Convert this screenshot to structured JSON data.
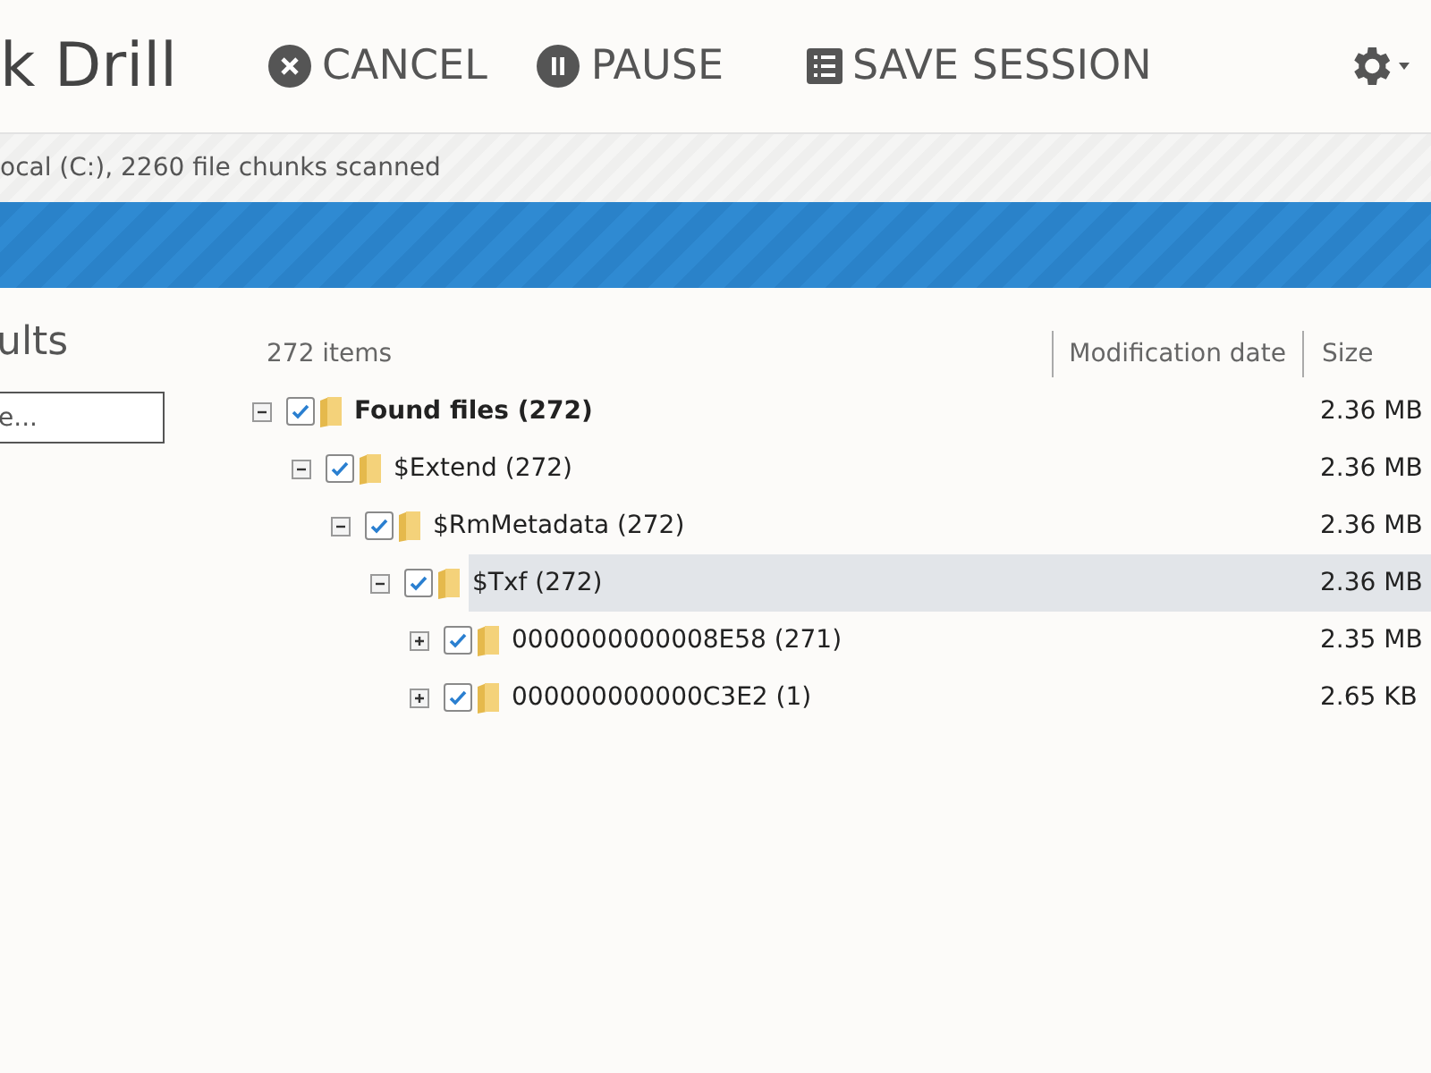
{
  "header": {
    "title": "k Drill",
    "buttons": [
      {
        "label": "CANCEL",
        "kind": "cancel"
      },
      {
        "label": "PAUSE",
        "kind": "pause"
      },
      {
        "label": "SAVE SESSION",
        "kind": "save"
      }
    ]
  },
  "status_text": "ocal (C:), 2260 file chunks scanned",
  "progress": {
    "level": 1
  },
  "sidebar": {
    "heading": "ults",
    "search": {
      "placeholder": "e..."
    }
  },
  "table": {
    "item_count": "272 items",
    "columns": [
      "Modification date",
      "Size"
    ],
    "rows": [
      {
        "name": "Found files (272)",
        "bold": true,
        "size": "2.36 MB",
        "checked": true,
        "expanded": true,
        "selected": false,
        "children": [
          {
            "name": "$Extend (272)",
            "bold": false,
            "size": "2.36 MB",
            "checked": true,
            "expanded": true,
            "selected": false,
            "children": [
              {
                "name": "$RmMetadata (272)",
                "bold": false,
                "size": "2.36 MB",
                "checked": true,
                "expanded": true,
                "selected": false,
                "children": [
                  {
                    "name": "$Txf (272)",
                    "bold": false,
                    "size": "2.36 MB",
                    "checked": true,
                    "expanded": true,
                    "selected": true,
                    "children": [
                      {
                        "name": "0000000000008E58 (271)",
                        "bold": false,
                        "size": "2.35 MB",
                        "checked": true,
                        "expanded": false,
                        "selected": false
                      },
                      {
                        "name": "000000000000C3E2 (1)",
                        "bold": false,
                        "size": "2.65 KB",
                        "checked": true,
                        "expanded": false,
                        "selected": false
                      }
                    ]
                  }
                ]
              }
            ]
          }
        ]
      }
    ]
  }
}
